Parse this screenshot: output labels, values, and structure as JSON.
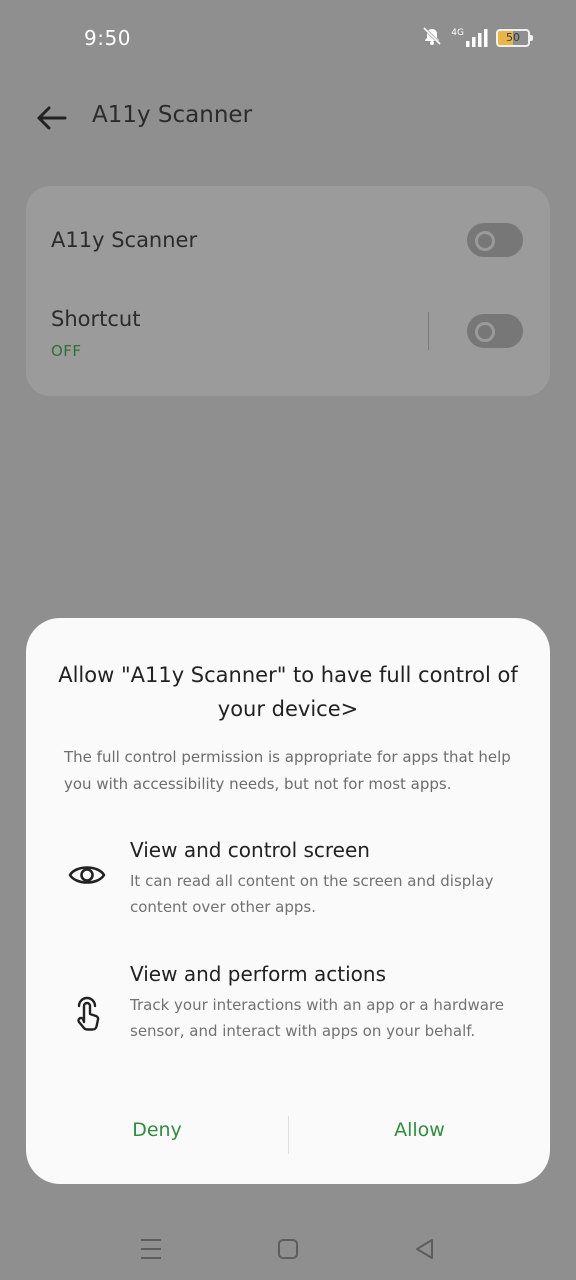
{
  "status_bar": {
    "time": "9:50",
    "network": "4G",
    "battery": "50"
  },
  "header": {
    "title": "A11y Scanner",
    "back_icon": "arrow-left-icon"
  },
  "settings": {
    "items": [
      {
        "label": "A11y Scanner",
        "toggle_state": "off"
      },
      {
        "label": "Shortcut",
        "subtitle": "OFF",
        "toggle_state": "off"
      }
    ]
  },
  "dialog": {
    "title": "Allow \"A11y Scanner\" to have full control of your device>",
    "description": "The full control permission is appropriate for apps that help you with accessibility needs, but not for most apps.",
    "permissions": [
      {
        "icon": "eye-icon",
        "title": "View and control screen",
        "description": "It can read all content on the screen and display content over other apps."
      },
      {
        "icon": "touch-hand-icon",
        "title": "View and perform actions",
        "description": "Track your interactions with an app or a hardware sensor, and interact with apps on your behalf."
      }
    ],
    "deny_label": "Deny",
    "allow_label": "Allow"
  },
  "colors": {
    "accent": "#2e8f3d",
    "scrim": "#8f8f8f",
    "dialog_bg": "#fafafa"
  }
}
